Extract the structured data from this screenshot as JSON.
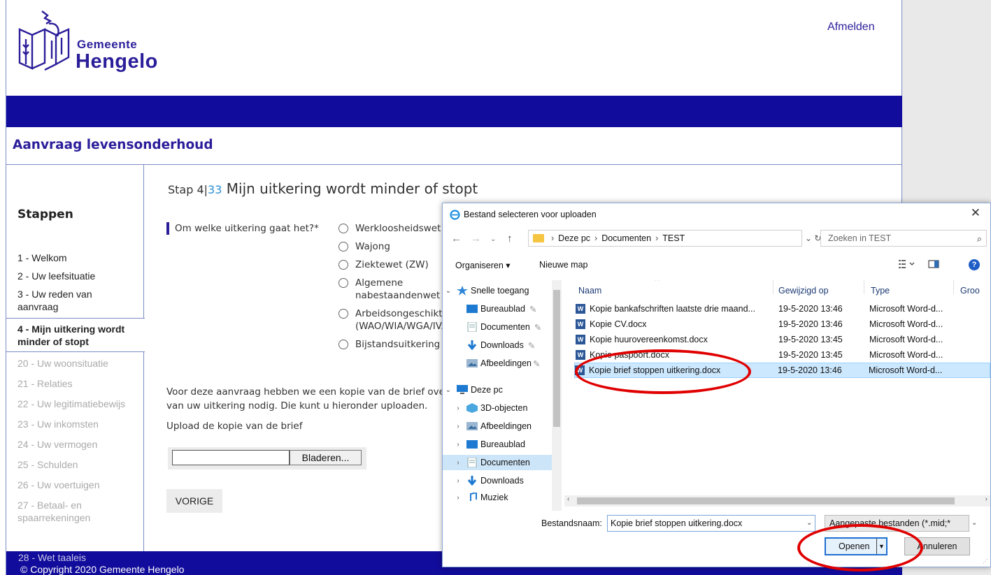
{
  "header": {
    "logo_line1": "Gemeente",
    "logo_line2": "Hengelo",
    "logout": "Afmelden",
    "app_title": "Aanvraag levensonderhoud"
  },
  "sidebar": {
    "title": "Stappen",
    "steps": [
      {
        "label": "1 - Welkom"
      },
      {
        "label": "2 - Uw leefsituatie"
      },
      {
        "label": "3 - Uw reden van aanvraag"
      },
      {
        "label": "4 - Mijn uitkering wordt minder of stopt"
      },
      {
        "label": "20 - Uw woonsituatie"
      },
      {
        "label": "21 - Relaties"
      },
      {
        "label": "22 - Uw legitimatiebewijs"
      },
      {
        "label": "23 - Uw inkomsten"
      },
      {
        "label": "24 - Uw vermogen"
      },
      {
        "label": "25 - Schulden"
      },
      {
        "label": "26 - Uw voertuigen"
      },
      {
        "label": "27 - Betaal- en spaarrekeningen"
      },
      {
        "label": "28 - Wet taaleis"
      }
    ]
  },
  "main": {
    "step_prefix": "Stap 4",
    "step_sep": "|",
    "step_total": "33",
    "step_title": "Mijn uitkering wordt minder of stopt",
    "question": "Om welke uitkering gaat het?*",
    "options": [
      "Werkloosheidswet",
      "Wajong",
      "Ziektewet (ZW)",
      "Algemene nabestaandenwet",
      "Arbeidsongeschiktheid (WAO/WIA/WGA/IVA)",
      "Bijstandsuitkering"
    ],
    "info_line1": "Voor deze aanvraag hebben we een kopie van de brief over",
    "info_line2": "van uw uitkering nodig. Die kunt u hieronder uploaden.",
    "upload_label": "Upload de kopie van de brief",
    "browse": "Bladeren...",
    "prev": "VORIGE",
    "copyright": "© Copyright 2020 Gemeente Hengelo"
  },
  "dialog": {
    "title": "Bestand selecteren voor uploaden",
    "path": [
      "Deze pc",
      "Documenten",
      "TEST"
    ],
    "search_placeholder": "Zoeken in TEST",
    "toolbar": {
      "organize": "Organiseren ▾",
      "new_folder": "Nieuwe map"
    },
    "tree": [
      {
        "label": "Snelle toegang",
        "icon": "star-icon"
      },
      {
        "label": "Bureaublad",
        "icon": "desktop-folder-icon"
      },
      {
        "label": "Documenten",
        "icon": "documents-folder-icon"
      },
      {
        "label": "Downloads",
        "icon": "downloads-folder-icon"
      },
      {
        "label": "Afbeeldingen",
        "icon": "pictures-folder-icon"
      },
      {
        "label": "Deze pc",
        "icon": "computer-icon"
      },
      {
        "label": "3D-objecten",
        "icon": "3d-objects-icon"
      },
      {
        "label": "Afbeeldingen",
        "icon": "pictures-folder-icon"
      },
      {
        "label": "Bureaublad",
        "icon": "desktop-folder-icon"
      },
      {
        "label": "Documenten",
        "icon": "documents-folder-icon"
      },
      {
        "label": "Downloads",
        "icon": "downloads-folder-icon"
      },
      {
        "label": "Muziek",
        "icon": "music-folder-icon"
      }
    ],
    "columns": {
      "name": "Naam",
      "modified": "Gewijzigd op",
      "type": "Type",
      "size": "Groo"
    },
    "files": [
      {
        "name": "Kopie bankafschriften laatste drie maand...",
        "modified": "19-5-2020 13:46",
        "type": "Microsoft Word-d..."
      },
      {
        "name": "Kopie CV.docx",
        "modified": "19-5-2020 13:46",
        "type": "Microsoft Word-d..."
      },
      {
        "name": "Kopie huurovereenkomst.docx",
        "modified": "19-5-2020 13:45",
        "type": "Microsoft Word-d..."
      },
      {
        "name": "Kopie paspoort.docx",
        "modified": "19-5-2020 13:45",
        "type": "Microsoft Word-d..."
      },
      {
        "name": "Kopie brief stoppen uitkering.docx",
        "modified": "19-5-2020 13:46",
        "type": "Microsoft Word-d..."
      }
    ],
    "filename_label": "Bestandsnaam:",
    "filename_value": "Kopie brief stoppen uitkering.docx",
    "filter": "Aangepaste bestanden (*.mid;*",
    "open": "Openen",
    "cancel": "Annuleren"
  },
  "colors": {
    "brand_blue": "#120c9c",
    "link_blue": "#2b1e9a",
    "annotation_red": "#e00000"
  }
}
